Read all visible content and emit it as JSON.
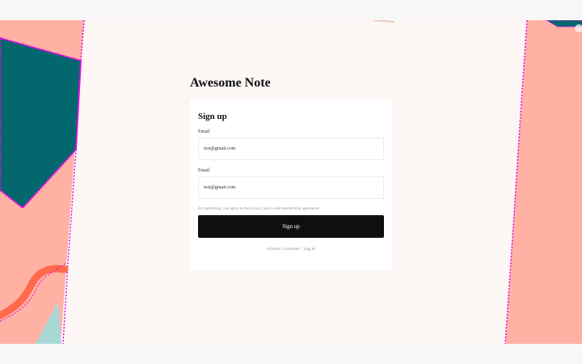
{
  "app": {
    "title": "Awesome Note"
  },
  "signup": {
    "heading": "Sign up",
    "fields": [
      {
        "label": "Email",
        "value": "test@gmail.com"
      },
      {
        "label": "Email",
        "value": "test@gmail.com"
      }
    ],
    "agreement": "By registering, you agree to the privacy policy and membership agreement.",
    "submit_label": "Sign up",
    "member_prompt": "Already a member?",
    "login_link": "Log in"
  },
  "colors": {
    "panel_pink": "#ffb1a3",
    "teal": "#02686d",
    "accent_magenta": "#e700e9",
    "orange": "#ff6a4d",
    "light_teal": "#a8d8d5",
    "button": "#0f0f0f"
  }
}
